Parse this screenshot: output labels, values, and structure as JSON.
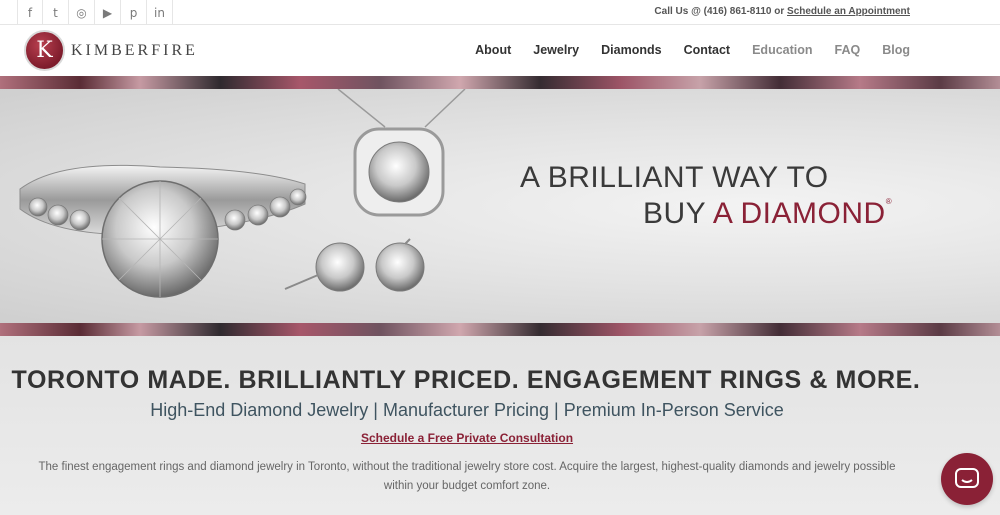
{
  "social": {
    "icons": [
      "facebook-icon",
      "twitter-icon",
      "instagram-icon",
      "youtube-icon",
      "pinterest-icon",
      "linkedin-icon"
    ],
    "glyphs": [
      "f",
      "t",
      "◎",
      "▶",
      "p",
      "in"
    ]
  },
  "contact": {
    "prefix": "Call Us @ (416) 861-8110 or ",
    "appointment": "Schedule an Appointment"
  },
  "logo": {
    "mark": "K",
    "text": "KIMBERFIRE"
  },
  "nav": {
    "about": "About",
    "jewelry": "Jewelry",
    "diamonds": "Diamonds",
    "contact": "Contact",
    "education": "Education",
    "faq": "FAQ",
    "blog": "Blog"
  },
  "hero": {
    "line1": "A BRILLIANT WAY TO",
    "line2_prefix": "BUY ",
    "line2_accent": "A DIAMOND",
    "mark": "®"
  },
  "main": {
    "headline": "TORONTO MADE. BRILLIANTLY PRICED. ENGAGEMENT RINGS & MORE.",
    "subline": "High-End Diamond Jewelry  |  Manufacturer Pricing  |  Premium In-Person Service",
    "consult": "Schedule a Free Private Consultation",
    "description": "The finest engagement rings and diamond jewelry in Toronto, without the traditional jewelry store cost. Acquire the largest, highest-quality diamonds and jewelry possible within your budget comfort zone."
  },
  "colors": {
    "brand": "#8a2136",
    "text": "#333333",
    "subline": "#3f5460"
  },
  "chat": {
    "icon": "chat-icon"
  }
}
